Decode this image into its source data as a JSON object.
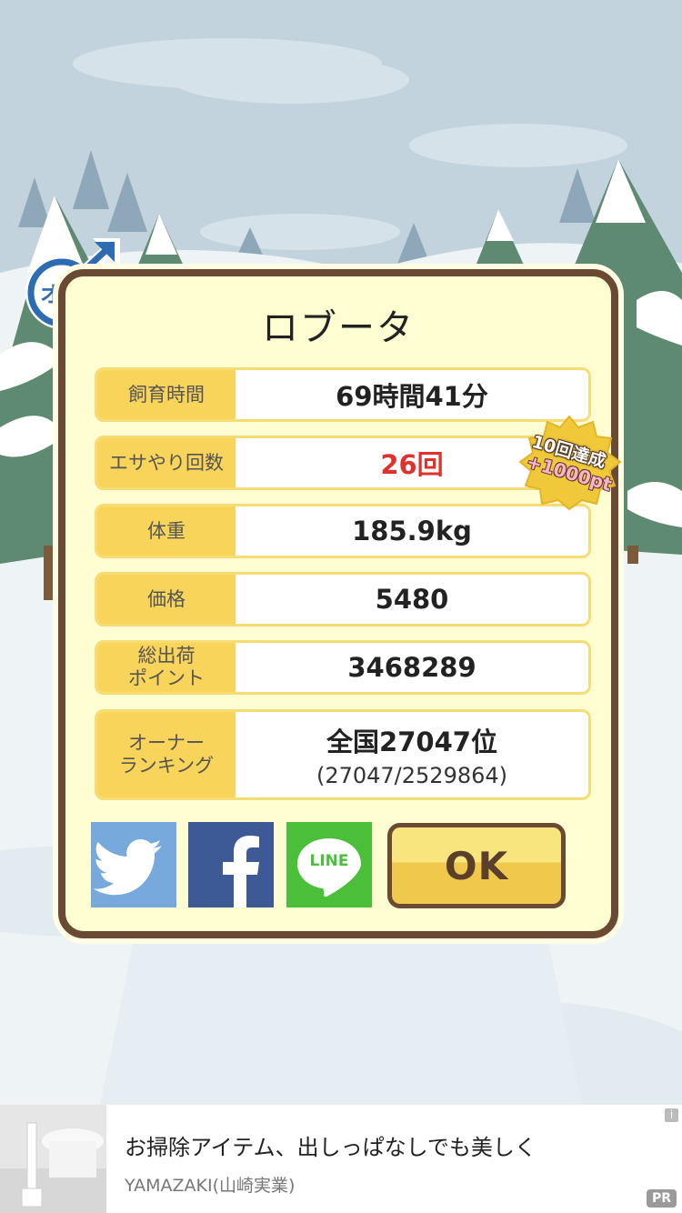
{
  "character": {
    "name": "ロブータ",
    "gender_label": "オス"
  },
  "stats": [
    {
      "label": "飼育時間",
      "value": "69時間41分"
    },
    {
      "label": "エサやり回数",
      "value": "26回"
    },
    {
      "label": "体重",
      "value": "185.9kg"
    },
    {
      "label": "価格",
      "value": "5480"
    },
    {
      "label": "総出荷\nポイント",
      "value": "3468289"
    },
    {
      "label": "オーナー\nランキング",
      "value": "全国27047位",
      "sub": "(27047/2529864)"
    }
  ],
  "achievement": {
    "line1": "10回達成",
    "line2": "+1000pt"
  },
  "share": {
    "line_label": "LINE"
  },
  "ok_label": "OK",
  "ad": {
    "headline": "お掃除アイテム、出しっぱなしでも美しく",
    "brand": "YAMAZAKI(山崎実業)",
    "badge": "PR",
    "info_icon": "i"
  },
  "colors": {
    "card_border": "#6b4a34",
    "card_bg": "#fffdd2",
    "label_bg": "#f8d45a",
    "highlight_value": "#e0322c",
    "twitter": "#77a9dc",
    "facebook": "#3d5a96",
    "line": "#4bbf3a",
    "ok_top": "#f9e57d",
    "ok_bottom": "#f0c84c"
  }
}
